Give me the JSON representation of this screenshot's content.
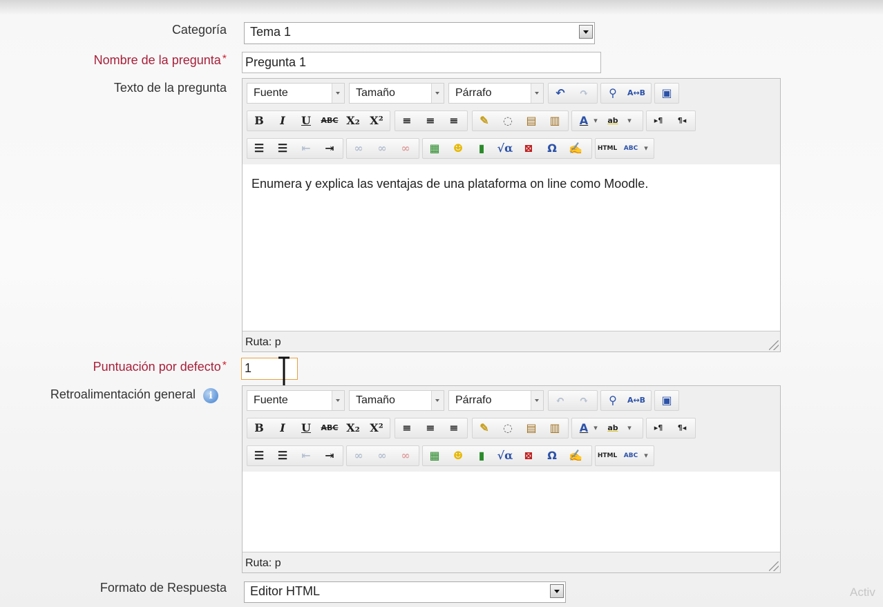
{
  "category": {
    "label": "Categoría",
    "value": "Tema 1"
  },
  "question_name": {
    "label": "Nombre de la pregunta",
    "required_mark": "*",
    "value": "Pregunta 1"
  },
  "question_text": {
    "label": "Texto de la pregunta",
    "content": "Enumera y explica las ventajas de una plataforma on line como Moodle.",
    "path": "Ruta: p"
  },
  "default_grade": {
    "label": "Puntuación por defecto",
    "required_mark": "*",
    "value": "1"
  },
  "general_feedback": {
    "label": "Retroalimentación general",
    "content": "",
    "path": "Ruta: p",
    "help_icon": "info-icon"
  },
  "response_format": {
    "label": "Formato de Respuesta",
    "value": "Editor HTML"
  },
  "toolbar": {
    "font": "Fuente",
    "size": "Tamaño",
    "paragraph": "Párrafo",
    "bold": "B",
    "italic": "I",
    "underline": "U",
    "strikethrough": "ABC",
    "subscript": "X₂",
    "superscript": "X²",
    "font_color": "A",
    "highlight": "ab",
    "html": "HTML",
    "spell": "ABC",
    "ltr": "▸¶",
    "rtl": "¶◂",
    "omega": "Ω",
    "math": "√α"
  },
  "watermark": "Activ",
  "colors": {
    "required_label": "#a8203a",
    "required_star": "#d2202f",
    "toolbar_bg": "#efefef"
  }
}
